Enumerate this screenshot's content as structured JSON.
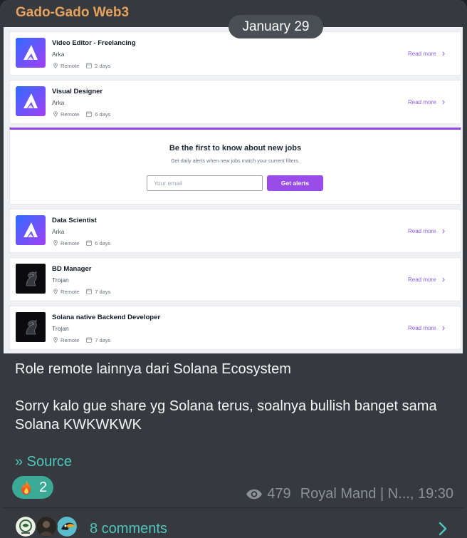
{
  "channel": {
    "name": "Gado-Gado Web3"
  },
  "date_badge": "January 29",
  "job_board": {
    "read_more_label": "Read more",
    "jobs": [
      {
        "title": "Video Editor - Freelancing",
        "company": "Arka",
        "location": "Remote",
        "posted": "2 days",
        "logo": "arka-logo"
      },
      {
        "title": "Visual Designer",
        "company": "Arka",
        "location": "Remote",
        "posted": "6 days",
        "logo": "arka-logo"
      },
      {
        "title": "Data Scientist",
        "company": "Arka",
        "location": "Remote",
        "posted": "6 days",
        "logo": "arka-logo"
      },
      {
        "title": "BD Manager",
        "company": "Trojan",
        "location": "Remote",
        "posted": "7 days",
        "logo": "trojan-logo"
      },
      {
        "title": "Solana native Backend Developer",
        "company": "Trojan",
        "location": "Remote",
        "posted": "7 days",
        "logo": "trojan-logo"
      }
    ],
    "alert_box": {
      "title": "Be the first to know about new jobs",
      "subtitle": "Get daily alerts when new jobs match your current filters.",
      "email_placeholder": "Your email",
      "button_label": "Get alerts"
    }
  },
  "message": {
    "line_1": "Role remote lainnya dari Solana Ecosystem",
    "line_2": "Sorry kalo gue share yg Solana terus, soalnya bullish banget sama Solana KWKWKWK",
    "source_link": "» Source"
  },
  "reactions": [
    {
      "icon": "fire-icon",
      "count": "2"
    }
  ],
  "views": "479",
  "signature": "Royal Mand | N..., 19:30",
  "comments": {
    "label": "8 comments"
  },
  "icons": {
    "views": "eye-icon",
    "comments_arrow": "chevron-right-icon",
    "location": "location-pin-icon",
    "posted": "calendar-icon"
  },
  "colors": {
    "channel": "#e8a25c",
    "link": "#4fc6be",
    "reaction": "#3aa996",
    "accent": "#8b5cf6",
    "alert-btn": "#9a4ce9"
  }
}
